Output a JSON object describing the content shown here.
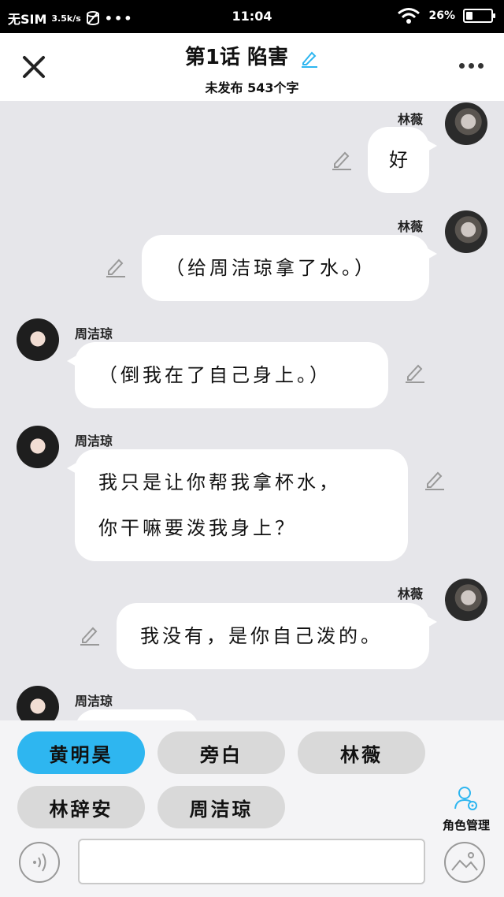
{
  "status_bar": {
    "carrier": "无SIM",
    "speed": "3.5k/s",
    "dots": "•••",
    "time": "11:04",
    "battery_text": "26%",
    "battery_level": 0.26
  },
  "header": {
    "title": "第1话 陷害",
    "subtitle": "未发布 543个字"
  },
  "messages": [
    {
      "side": "right",
      "name": "林薇",
      "lines": [
        "好"
      ]
    },
    {
      "side": "right",
      "name": "林薇",
      "lines": [
        "（给周洁琼拿了水。）"
      ]
    },
    {
      "side": "left",
      "name": "周洁琼",
      "lines": [
        "（倒我在了自己身上。）"
      ]
    },
    {
      "side": "left",
      "name": "周洁琼",
      "lines": [
        "我只是让你帮我拿杯水，",
        "你干嘛要泼我身上？"
      ]
    },
    {
      "side": "right",
      "name": "林薇",
      "lines": [
        "我没有，是你自己泼的。"
      ]
    },
    {
      "side": "left",
      "name": "周洁琼",
      "lines": [
        ""
      ]
    }
  ],
  "roles": [
    "黄明昊",
    "旁白",
    "林薇",
    "林辞安",
    "周洁琼"
  ],
  "active_role": "黄明昊",
  "role_manager_label": "角色管理",
  "input": {
    "value": "",
    "placeholder": ""
  },
  "colors": {
    "accent": "#2eb6f0",
    "chip": "#d9d9d9",
    "background": "#e6e6ea"
  }
}
